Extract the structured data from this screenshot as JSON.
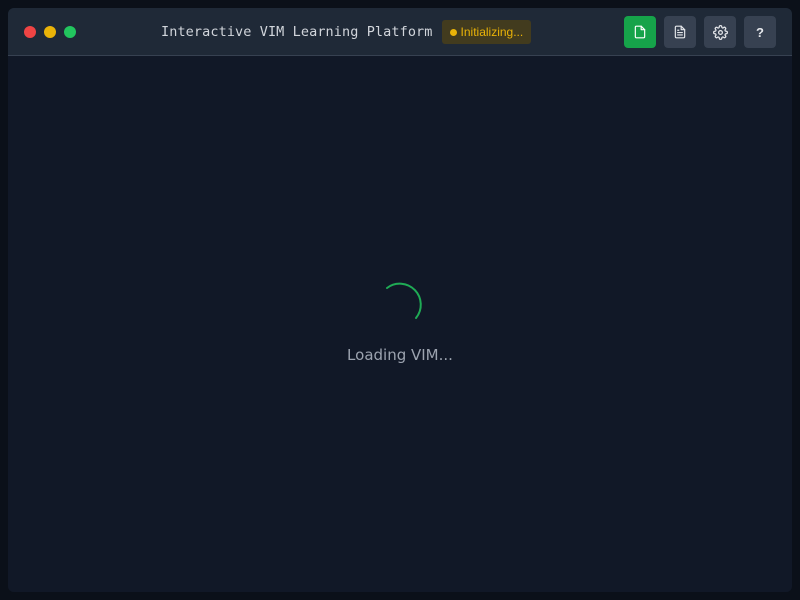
{
  "window": {
    "title": "Interactive VIM Learning Platform",
    "status": {
      "label": "Initializing...",
      "color": "#eab308"
    },
    "traffic_lights": [
      "close",
      "minimize",
      "maximize"
    ],
    "colors": {
      "close": "#ef4444",
      "minimize": "#eab308",
      "maximize": "#22c55e",
      "accent": "#16a34a",
      "background": "#111827"
    }
  },
  "toolbar": {
    "buttons": [
      {
        "name": "new-file",
        "icon": "file-icon"
      },
      {
        "name": "document",
        "icon": "file-text-icon"
      },
      {
        "name": "settings",
        "icon": "gear-icon"
      },
      {
        "name": "help",
        "icon": "help-icon",
        "glyph": "?"
      }
    ]
  },
  "main": {
    "loading_text": "Loading VIM...",
    "spinner_color": "#22c55e"
  }
}
